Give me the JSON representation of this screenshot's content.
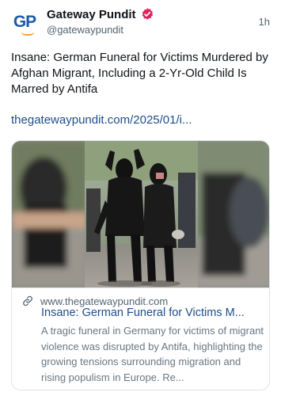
{
  "author": {
    "avatar_text": "GP",
    "name": "Gateway Pundit",
    "handle": "@gatewaypundit",
    "time": "1h",
    "verified_color": "#e0245e"
  },
  "post": {
    "text": "Insane: German Funeral for Victims Murdered by Afghan Migrant, Including a 2-Yr-Old Child Is Marred by Antifa",
    "link": "thegatewaypundit.com/2025/01/i..."
  },
  "card": {
    "image_alt": "Protesters dressed in black with masks at a funeral procession",
    "domain": "www.thegatewaypundit.com",
    "title": "Insane: German Funeral for Victims M...",
    "description": "A tragic funeral in Germany for victims of migrant violence was disrupted by Antifa, highlighting the growing tensions surrounding migration and rising populism in Europe. Re...",
    "link_icon": "link-icon"
  },
  "colors": {
    "link": "#1d4e89",
    "secondary_text": "#536471",
    "brand_blue": "#1c5aa8",
    "brand_orange": "#f2a531"
  }
}
